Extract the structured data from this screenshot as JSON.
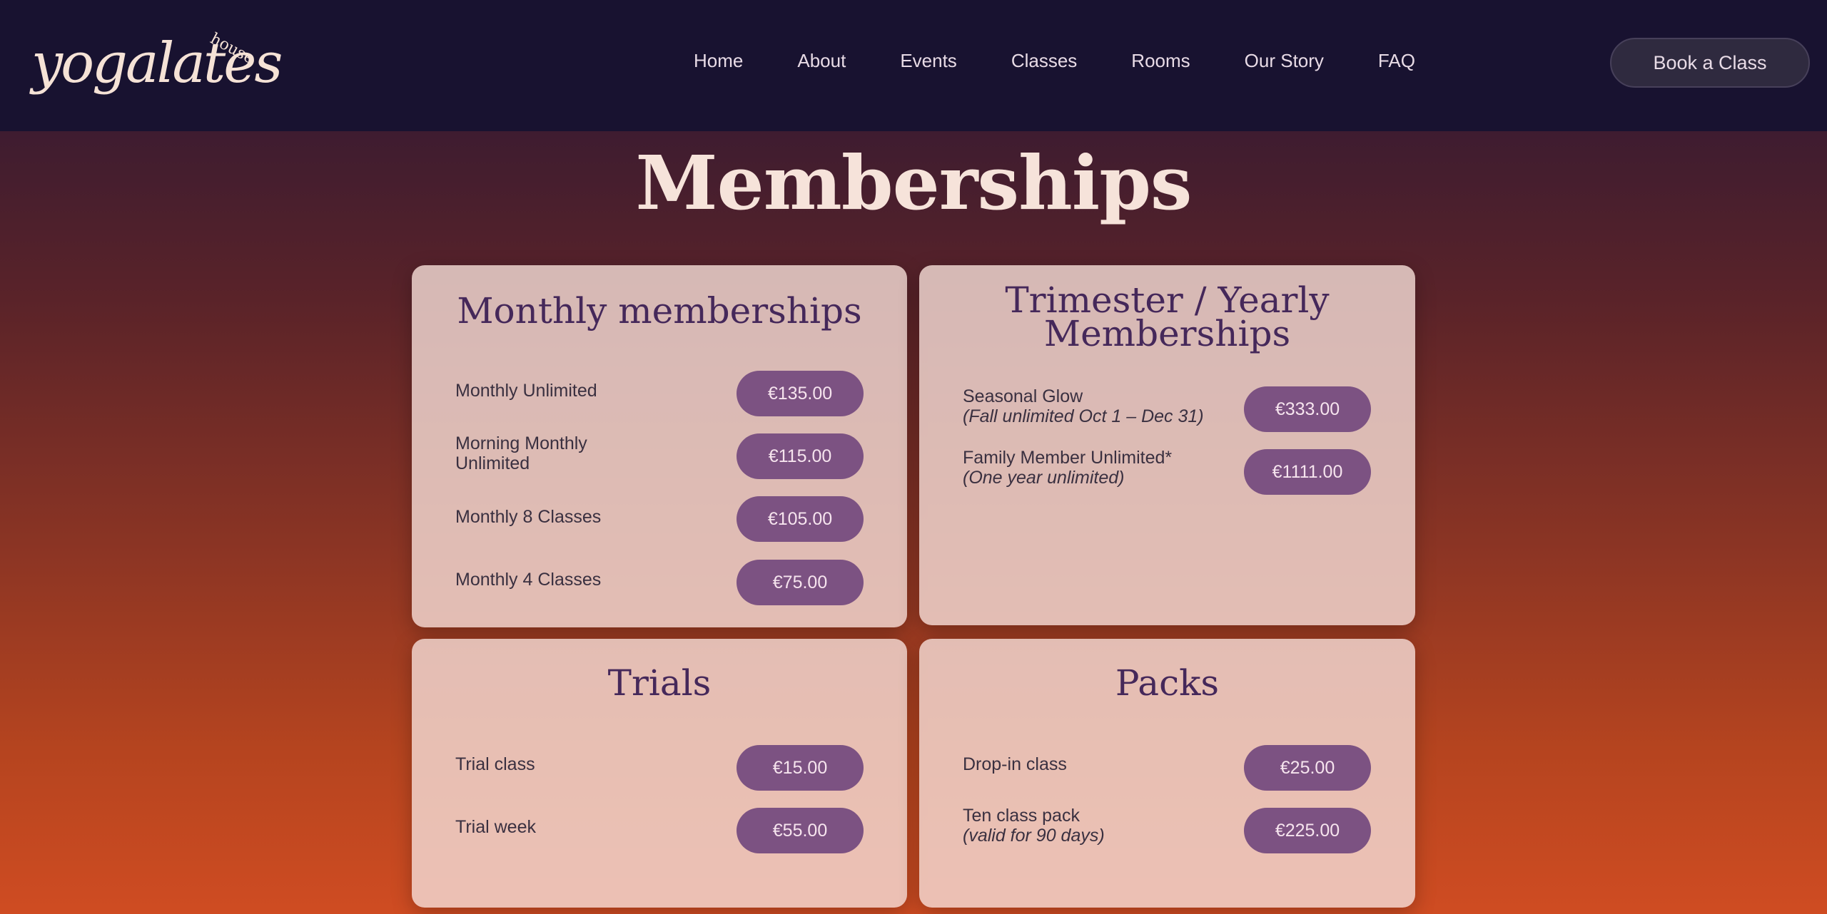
{
  "header": {
    "logo_text": "yogalates",
    "logo_sup": "house",
    "nav": [
      "Home",
      "About",
      "Events",
      "Classes",
      "Rooms",
      "Our Story",
      "FAQ"
    ],
    "book_label": "Book a Class"
  },
  "page_title": "Memberships",
  "cards": {
    "monthly": {
      "title": "Monthly memberships",
      "rows": [
        {
          "label": "Monthly Unlimited",
          "price": "€135.00"
        },
        {
          "label": "Morning Monthly Unlimited",
          "price": "€115.00"
        },
        {
          "label": "Monthly 8 Classes",
          "price": "€105.00"
        },
        {
          "label": "Monthly 4 Classes",
          "price": "€75.00"
        }
      ]
    },
    "yearly": {
      "title_line1": "Trimester / Yearly",
      "title_line2": "Memberships",
      "rows": [
        {
          "label": "Seasonal Glow",
          "sub": "(Fall unlimited Oct 1 – Dec 31)",
          "price": "€333.00"
        },
        {
          "label": "Family Member Unlimited*",
          "sub": "(One year unlimited)",
          "price": "€1111.00"
        }
      ]
    },
    "trials": {
      "title": "Trials",
      "rows": [
        {
          "label": "Trial class",
          "price": "€15.00"
        },
        {
          "label": "Trial week",
          "price": "€55.00"
        }
      ]
    },
    "packs": {
      "title": "Packs",
      "rows": [
        {
          "label": "Drop-in class",
          "price": "€25.00"
        },
        {
          "label": "Ten class pack",
          "sub": "(valid for 90 days)",
          "price": "€225.00"
        }
      ]
    }
  }
}
